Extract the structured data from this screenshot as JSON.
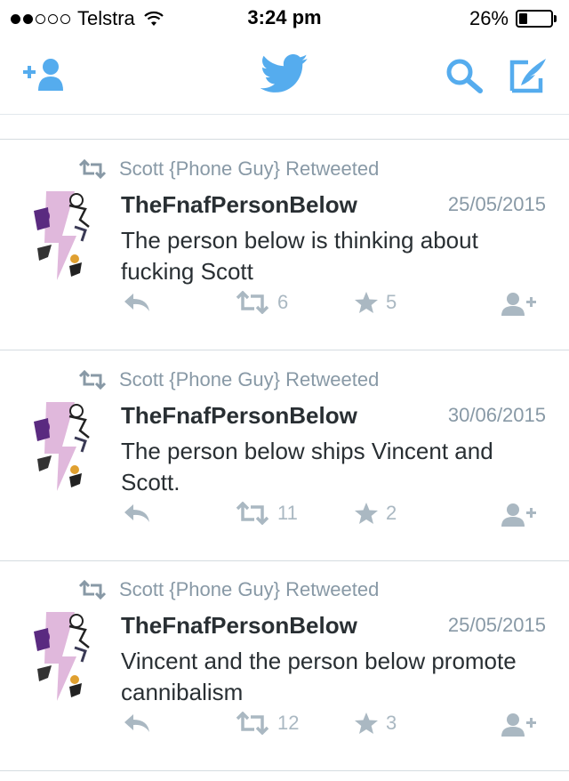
{
  "status_bar": {
    "carrier": "Telstra",
    "time": "3:24 pm",
    "battery": "26%",
    "battery_level": 0.26,
    "signal_bars": 2,
    "signal_total": 5
  },
  "nav": {
    "icons": [
      "add-user-icon",
      "twitter-bird-icon",
      "search-icon",
      "compose-icon"
    ],
    "accent_color": "#55acee"
  },
  "colors": {
    "secondary_text": "#8899a6",
    "action_icon": "#aab8c2",
    "primary_text": "#292f33"
  },
  "tweets": [
    {
      "retweeted_by": "Scott {Phone Guy} Retweeted",
      "author": "TheFnafPersonBelow",
      "date": "25/05/2015",
      "text": "The person below is thinking about fucking Scott",
      "retweets": "6",
      "favorites": "5"
    },
    {
      "retweeted_by": "Scott {Phone Guy} Retweeted",
      "author": "TheFnafPersonBelow",
      "date": "30/06/2015",
      "text": "The person below ships Vincent and Scott.",
      "retweets": "11",
      "favorites": "2"
    },
    {
      "retweeted_by": "Scott {Phone Guy} Retweeted",
      "author": "TheFnafPersonBelow",
      "date": "25/05/2015",
      "text": "Vincent and the person below promote cannibalism",
      "retweets": "12",
      "favorites": "3"
    }
  ]
}
